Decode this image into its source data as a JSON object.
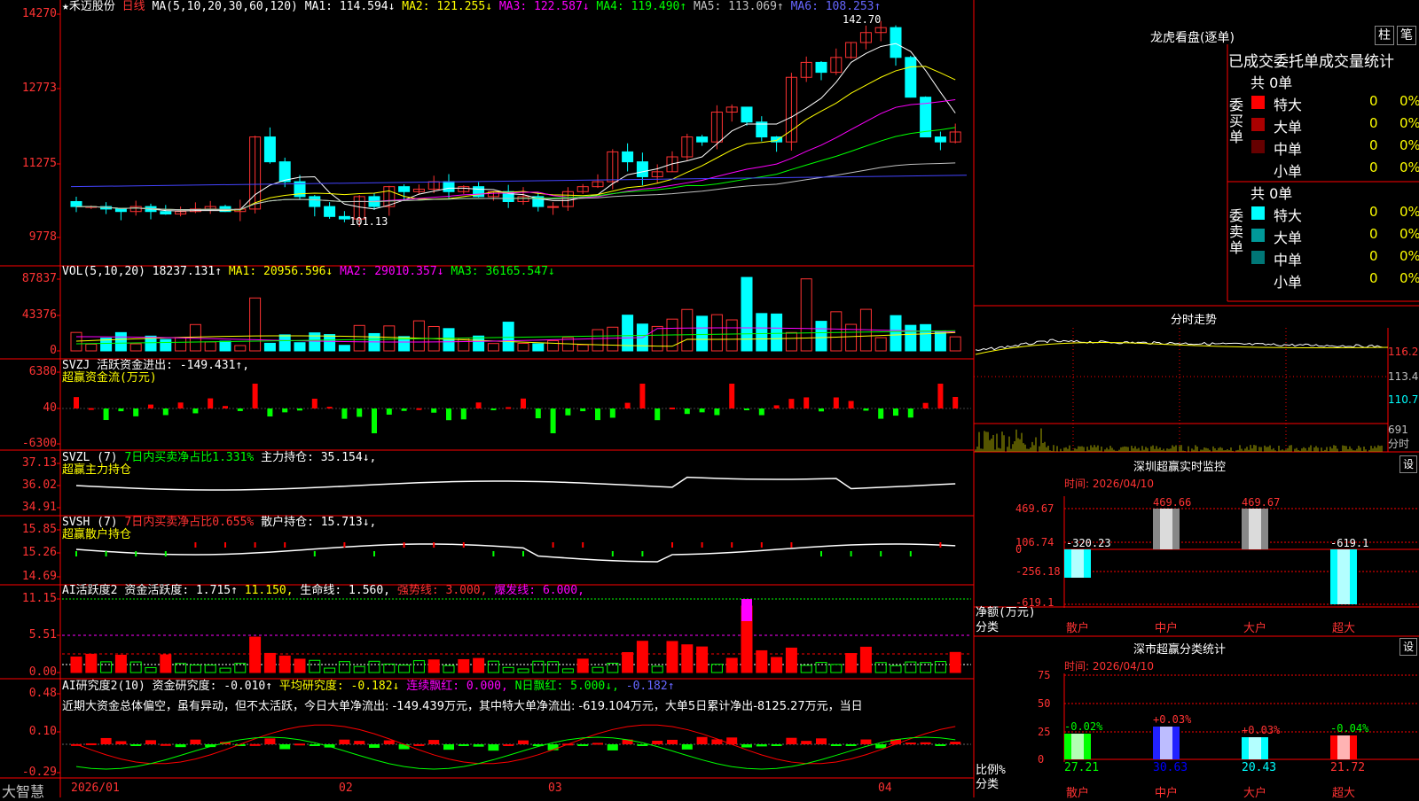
{
  "stock": {
    "name": "★禾迈股份",
    "period": "日线",
    "ma_label": "MA(5,10,20,30,60,120)",
    "ma": [
      {
        "t": "MA1: 114.594↓",
        "c": "#ffffff"
      },
      {
        "t": "MA2: 121.255↓",
        "c": "#ffff00"
      },
      {
        "t": "MA3: 122.587↓",
        "c": "#ff00ff"
      },
      {
        "t": "MA4: 119.490↑",
        "c": "#00ff00"
      },
      {
        "t": "MA5: 113.069↑",
        "c": "#c0c0c0"
      },
      {
        "t": "MA6: 108.253↑",
        "c": "#6666ff"
      }
    ],
    "high_label": "142.70",
    "low_label": "101.13",
    "y_ticks": [
      "14270",
      "12773",
      "11275",
      "9778"
    ]
  },
  "vol": {
    "title": "VOL(5,10,20)",
    "value": "18237.131↑",
    "ma1": "MA1: 20956.596↓",
    "ma2": "MA2: 29010.357↓",
    "ma3": "MA3: 36165.547↓",
    "y_ticks": [
      "87837",
      "43376",
      "0"
    ]
  },
  "svzj": {
    "title": "SVZJ",
    "label": "活跃资金进出: -149.431↑,",
    "sub": "超赢资金流(万元)",
    "y_ticks": [
      "6380",
      "40",
      "-6300"
    ]
  },
  "svzl": {
    "title": "SVZL (7)",
    "label1": "7日内买卖净占比1.331%",
    "label2": "主力持仓: 35.154↓,",
    "sub": "超赢主力持仓",
    "y_ticks": [
      "37.13",
      "36.02",
      "34.91"
    ]
  },
  "svsh": {
    "title": "SVSH (7)",
    "label1": "7日内买卖净占比0.655%",
    "label2": "散户持仓: 15.713↓,",
    "sub": "超赢散户持仓",
    "y_ticks": [
      "15.85",
      "15.26",
      "14.69"
    ]
  },
  "ai1": {
    "title": "AI活跃度2",
    "l1": "资金活跃度: 1.715↑",
    "l2": "11.150,",
    "l3": "生命线: 1.560,",
    "l4": "强势线: 3.000,",
    "l5": "爆发线: 6.000,",
    "y_ticks": [
      "11.15",
      "5.51",
      "0.00"
    ]
  },
  "ai2": {
    "title": "AI研究度2(10)",
    "l1": "资金研究度: -0.010↑",
    "l2": "平均研究度: -0.182↓",
    "l3": "连续飘红: 0.000,",
    "l4": "N日飘红: 5.000↓,",
    "l5": "-0.182↑",
    "desc": "近期大资金总体偏空，虽有异动，但不太活跃，今日大单净流出: -149.439万元，其中特大单净流出: -619.104万元，大单5日累计净出-8125.27万元，当日",
    "y_ticks": [
      "0.48",
      "0.10",
      "-0.29"
    ]
  },
  "xaxis": {
    "labels": [
      "2026/01",
      "02",
      "03",
      "04"
    ],
    "brand": "大智慧"
  },
  "longhu": {
    "title": "龙虎看盘(逐单)",
    "btn1": "柱",
    "btn2": "笔",
    "header": "已成交委托单成交量统计",
    "buy": {
      "side": "委买单",
      "total": "共 0单",
      "rows": [
        {
          "k": "特大",
          "v": "0",
          "p": "0%",
          "c": "#ff0000"
        },
        {
          "k": "大单",
          "v": "0",
          "p": "0%",
          "c": "#aa0000"
        },
        {
          "k": "中单",
          "v": "0",
          "p": "0%",
          "c": "#660000"
        },
        {
          "k": "小单",
          "v": "0",
          "p": "0%",
          "c": ""
        }
      ]
    },
    "sell": {
      "side": "委卖单",
      "total": "共 0单",
      "rows": [
        {
          "k": "特大",
          "v": "0",
          "p": "0%",
          "c": "#00ffff"
        },
        {
          "k": "大单",
          "v": "0",
          "p": "0%",
          "c": "#009999"
        },
        {
          "k": "中单",
          "v": "0",
          "p": "0%",
          "c": "#007777"
        },
        {
          "k": "小单",
          "v": "0",
          "p": "0%",
          "c": ""
        }
      ]
    }
  },
  "intraday": {
    "title": "分时走势",
    "y": [
      "116.2",
      "113.4",
      "110.7"
    ],
    "vol": "691",
    "unit": "分时"
  },
  "sz": {
    "title": "深圳超赢实时监控",
    "set": "设",
    "time": "时间: 2026/04/10",
    "y": [
      "469.67",
      "106.74",
      "0",
      "-256.18",
      "-619.1"
    ],
    "vals": [
      "-320.23",
      "469.66",
      "469.67",
      "-619.1"
    ],
    "cats": [
      "散户",
      "中户",
      "大户",
      "超大"
    ],
    "unit1": "净额(万元)",
    "unit2": "分类"
  },
  "ss": {
    "title": "深市超赢分类统计",
    "set": "设",
    "time": "时间: 2026/04/10",
    "y": [
      "75",
      "50",
      "25",
      "0"
    ],
    "top": [
      "-0.02%",
      "+0.03%",
      "+0.03%",
      "-0.04%"
    ],
    "vals": [
      "27.21",
      "30.63",
      "20.43",
      "21.72"
    ],
    "cats": [
      "散户",
      "中户",
      "大户",
      "超大"
    ],
    "unit1": "比例%",
    "unit2": "分类"
  }
}
